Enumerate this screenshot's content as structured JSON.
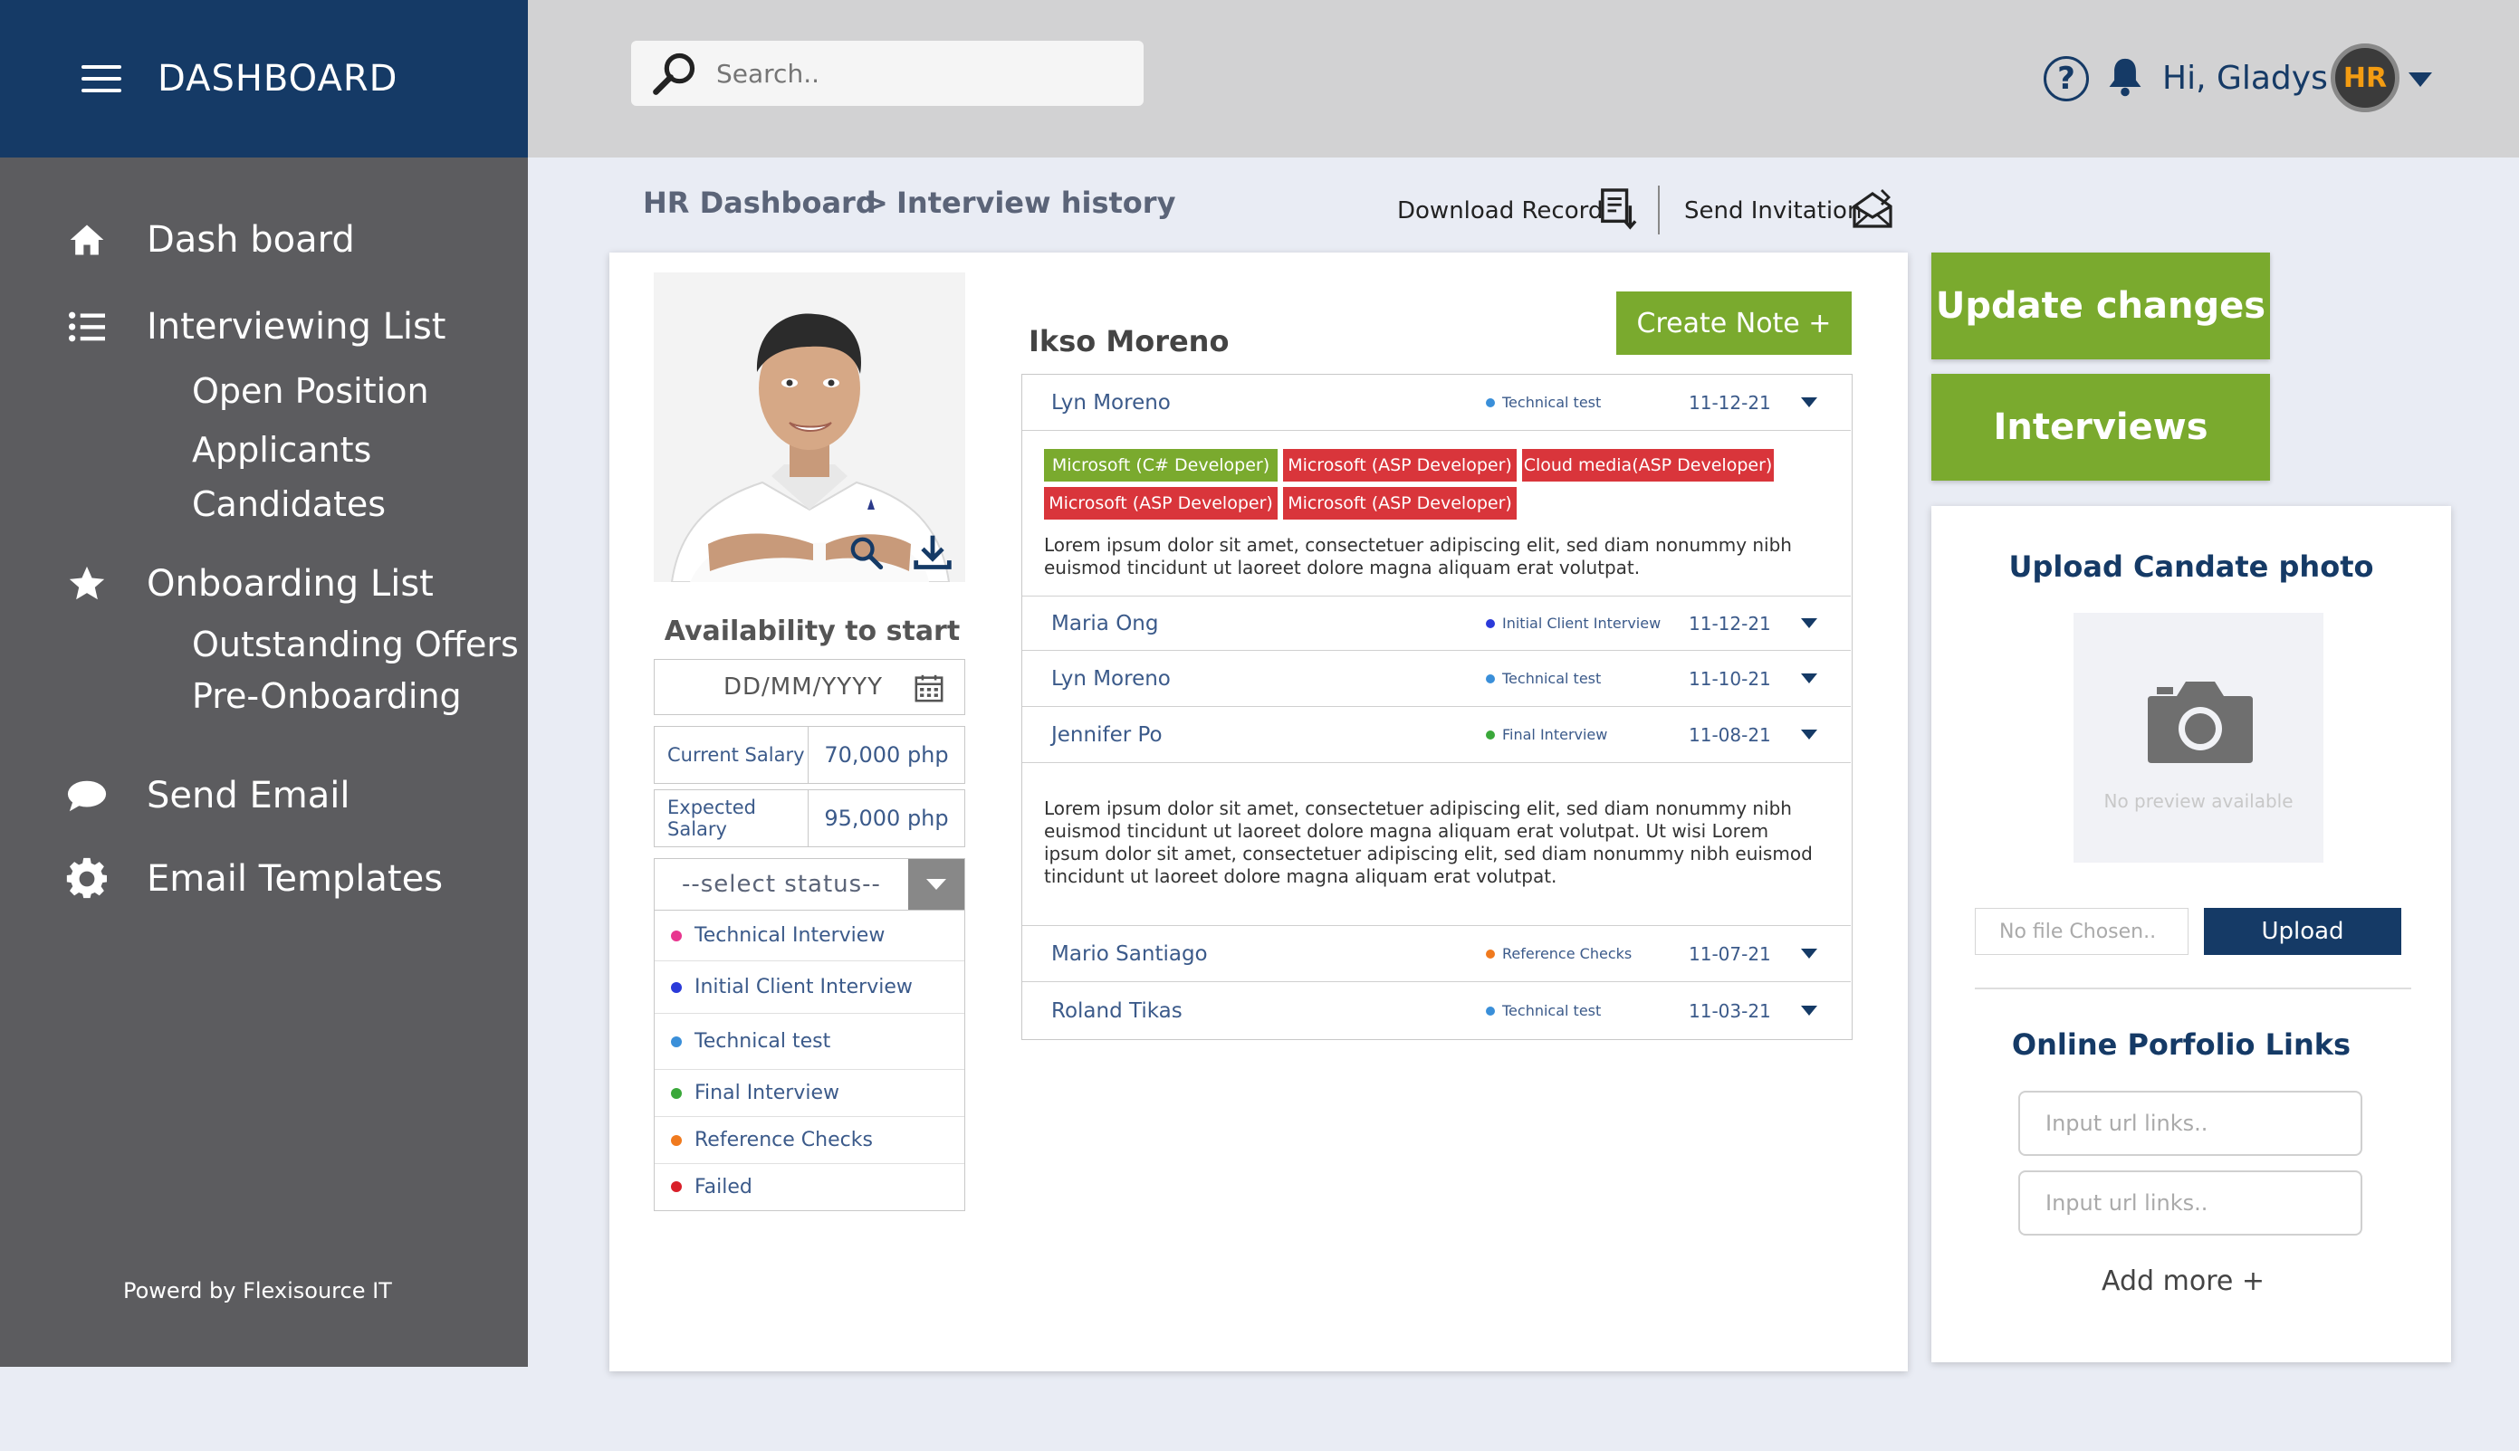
{
  "sidebar": {
    "title": "DASHBOARD",
    "items": [
      {
        "label": "Dash board",
        "icon": "home-icon"
      },
      {
        "label": "Interviewing List",
        "icon": "list-icon",
        "children": [
          "Open Position",
          "Applicants",
          "Candidates"
        ]
      },
      {
        "label": "Onboarding List",
        "icon": "star-icon",
        "children": [
          "Outstanding Offers",
          "Pre-Onboarding"
        ]
      },
      {
        "label": "Send Email",
        "icon": "chat-bubble-icon"
      },
      {
        "label": "Email Templates",
        "icon": "gear-icon"
      }
    ],
    "footer": "Powerd by Flexisource IT"
  },
  "topbar": {
    "search_placeholder": "Search..",
    "greeting": "Hi, Gladys !",
    "avatar_logo": "HR"
  },
  "breadcrumb": {
    "root": "HR Dashboard",
    "separator": ">",
    "current": "Interview history"
  },
  "actions": {
    "download": "Download Record",
    "invite": "Send Invitation"
  },
  "profile": {
    "availability_title": "Availability to start",
    "date_placeholder": "DD/MM/YYYY",
    "current_salary_label": "Current Salary",
    "current_salary_value": "70,000 php",
    "expected_salary_label": "Expected Salary",
    "expected_salary_value": "95,000 php",
    "status_placeholder": "--select status--",
    "statuses": [
      {
        "label": "Technical Interview",
        "color": "#e8368f"
      },
      {
        "label": "Initial Client Interview",
        "color": "#2b3ad9"
      },
      {
        "label": "Technical test",
        "color": "#3a8fd9"
      },
      {
        "label": "Final Interview",
        "color": "#3aa83a"
      },
      {
        "label": "Reference Checks",
        "color": "#f07a1e"
      },
      {
        "label": "Failed",
        "color": "#d9202a"
      }
    ]
  },
  "history": {
    "candidate_name": "Ikso Moreno",
    "create_note": "Create Note +",
    "tags": [
      {
        "label": "Microsoft (C# Developer)",
        "color": "#7aaa2e"
      },
      {
        "label": "Microsoft (ASP Developer)",
        "color": "#d9353b"
      },
      {
        "label": "Cloud media(ASP Developer)",
        "color": "#d9353b"
      },
      {
        "label": "Microsoft (ASP Developer)",
        "color": "#d9353b"
      },
      {
        "label": "Microsoft (ASP Developer)",
        "color": "#d9353b"
      }
    ],
    "note1": "Lorem ipsum dolor sit amet, consectetuer adipiscing elit, sed diam nonummy nibh euismod tincidunt ut laoreet dolore magna aliquam erat volutpat.",
    "note2": "Lorem ipsum dolor sit amet, consectetuer adipiscing elit, sed diam nonummy nibh euismod tincidunt ut laoreet dolore magna aliquam erat volutpat. Ut wisi Lorem ipsum dolor sit amet, consectetuer adipiscing elit, sed diam nonummy nibh euismod tincidunt ut laoreet dolore magna aliquam erat volutpat.",
    "rows": [
      {
        "name": "Lyn Moreno",
        "status": "Technical test",
        "status_color": "#3a8fd9",
        "date": "11-12-21"
      },
      {
        "name": "Maria Ong",
        "status": "Initial Client Interview",
        "status_color": "#2b3ad9",
        "date": "11-12-21"
      },
      {
        "name": "Lyn Moreno",
        "status": "Technical test",
        "status_color": "#3a8fd9",
        "date": "11-10-21"
      },
      {
        "name": "Jennifer Po",
        "status": "Final Interview",
        "status_color": "#3aa83a",
        "date": "11-08-21"
      },
      {
        "name": "Mario Santiago",
        "status": "Reference Checks",
        "status_color": "#f07a1e",
        "date": "11-07-21"
      },
      {
        "name": "Roland Tikas",
        "status": "Technical test",
        "status_color": "#3a8fd9",
        "date": "11-03-21"
      }
    ]
  },
  "right": {
    "update_label": "Update changes",
    "interviews_label": "Interviews",
    "upload_title": "Upload Candate photo",
    "no_preview": "No preview available",
    "file_placeholder": "No file Chosen..",
    "upload_button": "Upload",
    "portfolio_title": "Online Porfolio Links",
    "url_placeholder_1": "Input url links..",
    "url_placeholder_2": "Input url links..",
    "add_more": "Add more +"
  },
  "colors": {
    "brand_navy": "#153a66",
    "accent_green": "#7aaa2e",
    "tag_red": "#d9353b",
    "sidebar_gray": "#5c5c5f"
  }
}
